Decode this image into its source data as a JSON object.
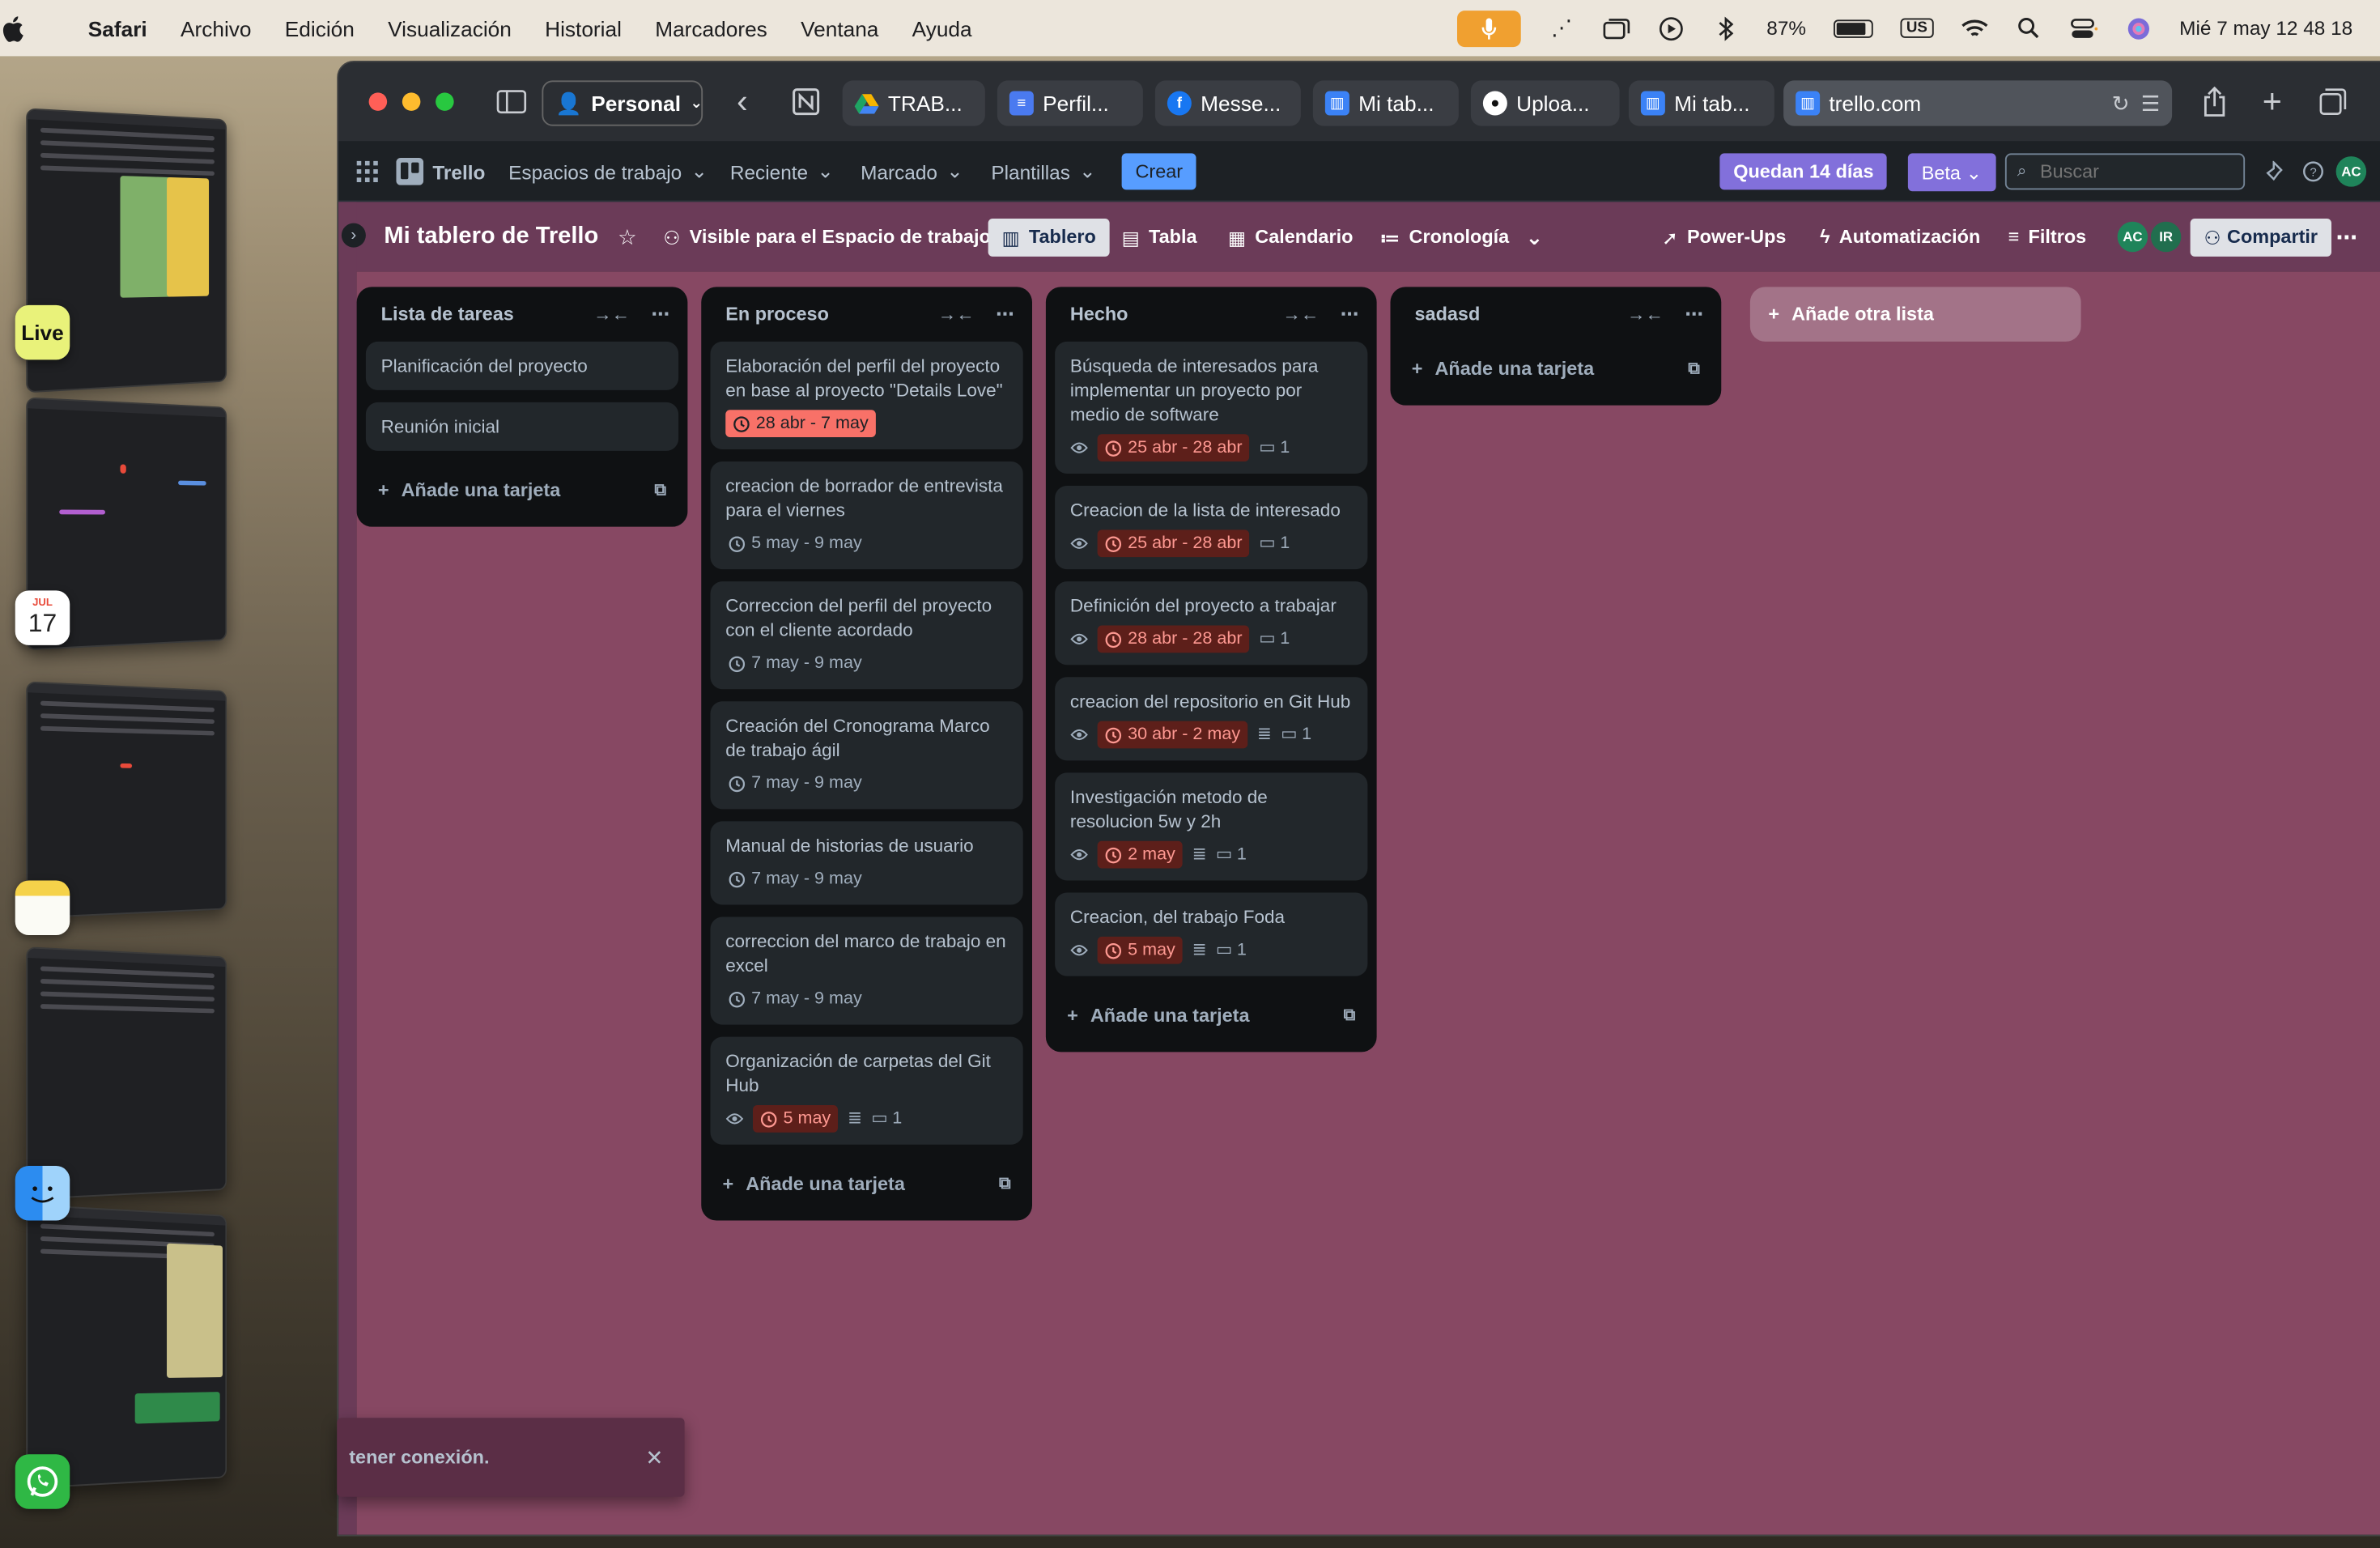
{
  "menubar": {
    "app": "Safari",
    "items": [
      "Archivo",
      "Edición",
      "Visualización",
      "Historial",
      "Marcadores",
      "Ventana",
      "Ayuda"
    ],
    "battery": "87%",
    "keyboard": "US",
    "datetime": "Mié 7 may  12 48 18"
  },
  "dock": {
    "live_label": "Live",
    "calendar_month": "JUL",
    "calendar_day": "17"
  },
  "safari": {
    "profile": "Personal",
    "tabs": [
      "TRAB...",
      "Perfil...",
      "Messe...",
      "Mi tab...",
      "Uploa...",
      "Mi tab..."
    ],
    "url": "trello.com"
  },
  "trello_nav": {
    "logo": "Trello",
    "workspaces": "Espacios de trabajo",
    "recent": "Reciente",
    "starred": "Marcado",
    "templates": "Plantillas",
    "create": "Crear",
    "trial": "Quedan 14 días",
    "beta": "Beta",
    "search_placeholder": "Buscar",
    "avatar": "AC"
  },
  "board_header": {
    "title": "Mi tablero de Trello",
    "visibility": "Visible para el Espacio de trabajo",
    "views": [
      "Tablero",
      "Tabla",
      "Calendario",
      "Cronología"
    ],
    "powerups": "Power-Ups",
    "automation": "Automatización",
    "filters": "Filtros",
    "members": [
      "AC",
      "IR"
    ],
    "share": "Compartir"
  },
  "lists": [
    {
      "title": "Lista de tareas",
      "cards": [
        {
          "title": "Planificación del proyecto"
        },
        {
          "title": "Reunión inicial"
        }
      ],
      "add_label": "Añade una tarjeta"
    },
    {
      "title": "En proceso",
      "cards": [
        {
          "title": "Elaboración del perfil del proyecto en base al proyecto \"Details Love\"",
          "due": "28 abr - 7 may",
          "due_style": "overdue"
        },
        {
          "title": "creacion de borrador de entrevista para el viernes",
          "due": "5 may - 9 may",
          "due_style": "plain"
        },
        {
          "title": "Correccion del perfil del proyecto con el cliente acordado",
          "due": "7 may - 9 may",
          "due_style": "plain"
        },
        {
          "title": "Creación del Cronograma Marco de trabajo ágil",
          "due": "7 may - 9 may",
          "due_style": "plain"
        },
        {
          "title": "Manual de historias de usuario",
          "due": "7 may - 9 may",
          "due_style": "plain"
        },
        {
          "title": "correccion del marco de trabajo en excel",
          "due": "7 may - 9 may",
          "due_style": "plain"
        },
        {
          "title": "Organización de carpetas del Git Hub",
          "due": "5 may",
          "due_style": "past",
          "watch": true,
          "desc": true,
          "comments": "1"
        }
      ],
      "add_label": "Añade una tarjeta"
    },
    {
      "title": "Hecho",
      "cards": [
        {
          "title": "Búsqueda de interesados para implementar un proyecto por medio de software",
          "due": "25 abr - 28 abr",
          "due_style": "past",
          "watch": true,
          "comments": "1"
        },
        {
          "title": "Creacion de la lista de interesado",
          "due": "25 abr - 28 abr",
          "due_style": "past",
          "watch": true,
          "comments": "1"
        },
        {
          "title": "Definición del proyecto a trabajar",
          "due": "28 abr - 28 abr",
          "due_style": "past",
          "watch": true,
          "comments": "1"
        },
        {
          "title": "creacion del repositorio en Git Hub",
          "due": "30 abr - 2 may",
          "due_style": "past",
          "watch": true,
          "desc": true,
          "comments": "1"
        },
        {
          "title": "Investigación metodo de resolucion 5w y 2h",
          "due": "2 may",
          "due_style": "past",
          "watch": true,
          "desc": true,
          "comments": "1"
        },
        {
          "title": "Creacion, del trabajo Foda",
          "due": "5 may",
          "due_style": "past",
          "watch": true,
          "desc": true,
          "comments": "1"
        }
      ],
      "add_label": "Añade una tarjeta"
    },
    {
      "title": "sadasd",
      "cards": [],
      "add_label": "Añade una tarjeta"
    }
  ],
  "add_list_label": "Añade otra lista",
  "toast": {
    "text": "tener conexión."
  }
}
